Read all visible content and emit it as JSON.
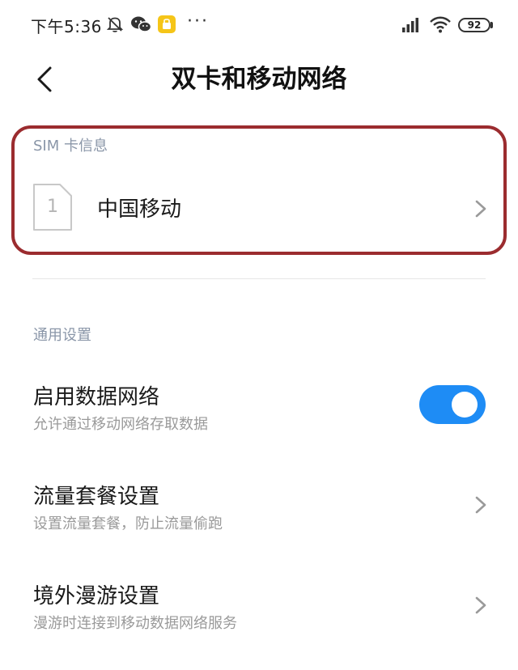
{
  "status_bar": {
    "time": "下午5:36",
    "battery": "92",
    "dots": "···"
  },
  "header": {
    "title": "双卡和移动网络"
  },
  "sim_section": {
    "label": "SIM 卡信息",
    "card_number": "1",
    "carrier": "中国移动"
  },
  "general_section": {
    "label": "通用设置",
    "items": [
      {
        "title": "启用数据网络",
        "subtitle": "允许通过移动网络存取数据",
        "enabled": true
      },
      {
        "title": "流量套餐设置",
        "subtitle": "设置流量套餐，防止流量偷跑"
      },
      {
        "title": "境外漫游设置",
        "subtitle": "漫游时连接到移动数据网络服务"
      }
    ]
  },
  "colors": {
    "accent": "#1e8cf5",
    "highlight_border": "#9b2c2f",
    "section_label": "#8a96a8"
  }
}
